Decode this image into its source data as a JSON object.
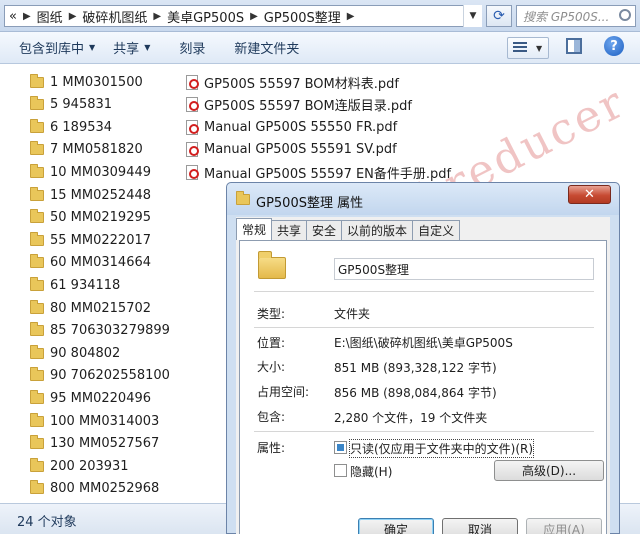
{
  "address": {
    "crumbs": [
      "«",
      "图纸",
      "破碎机图纸",
      "美卓GP500S",
      "GP500S整理"
    ],
    "search_placeholder": "搜索 GP500S..."
  },
  "toolbar": {
    "include_label": "包含到库中",
    "share_label": "共享",
    "burn_label": "刻录",
    "new_folder_label": "新建文件夹"
  },
  "folders": [
    "1  MM0301500",
    "5  945831",
    "6  189534",
    "7  MM0581820",
    "10  MM0309449",
    "15  MM0252448",
    "50  MM0219295",
    "55  MM0222017",
    "60  MM0314664",
    "61  934118",
    "80  MM0215702",
    "85  706303279899",
    "90  804802",
    "90  706202558100",
    "95  MM0220496",
    "100  MM0314003",
    "130  MM0527567",
    "200  203931",
    "800  MM0252968"
  ],
  "files": [
    "GP500S 55597 BOM材料表.pdf",
    "GP500S 55597 BOM连版目录.pdf",
    "Manual GP500S 55550 FR.pdf",
    "Manual GP500S 55591 SV.pdf",
    "Manual GP500S 55597 EN备件手册.pdf"
  ],
  "status": {
    "count_text": "24 个对象"
  },
  "watermark": "rexrothreducer",
  "dialog": {
    "title": "GP500S整理 属性",
    "close_label": "✕",
    "tabs": [
      "常规",
      "共享",
      "安全",
      "以前的版本",
      "自定义"
    ],
    "name_value": "GP500S整理",
    "props": [
      {
        "label": "类型:",
        "value": "文件夹"
      },
      {
        "label": "位置:",
        "value": "E:\\图纸\\破碎机图纸\\美卓GP500S"
      },
      {
        "label": "大小:",
        "value": "851 MB (893,328,122 字节)"
      },
      {
        "label": "占用空间:",
        "value": "856 MB (898,084,864 字节)"
      },
      {
        "label": "包含:",
        "value": "2,280 个文件，19 个文件夹"
      }
    ],
    "attributes_label": "属性:",
    "readonly_label": "只读(仅应用于文件夹中的文件)(R)",
    "hidden_label": "隐藏(H)",
    "advanced_label": "高级(D)...",
    "ok_label": "确定",
    "cancel_label": "取消",
    "apply_label": "应用(A)"
  }
}
